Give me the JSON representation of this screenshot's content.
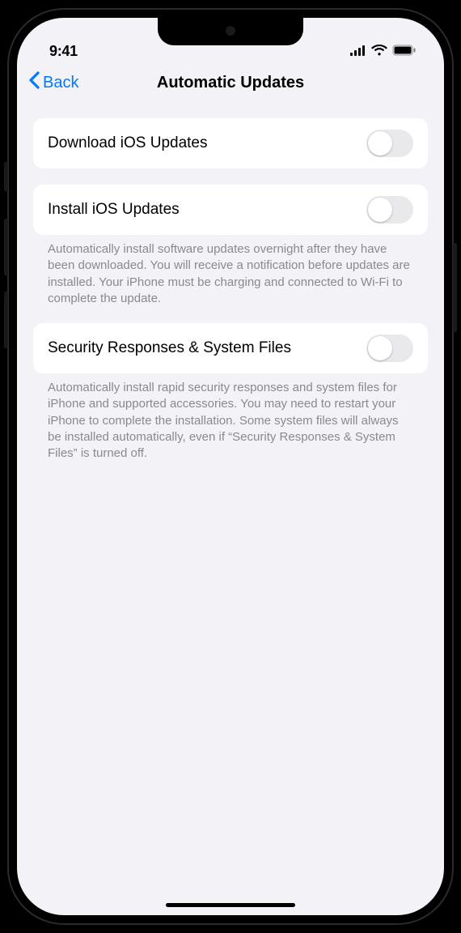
{
  "status": {
    "time": "9:41"
  },
  "nav": {
    "back_label": "Back",
    "title": "Automatic Updates"
  },
  "groups": [
    {
      "label": "Download iOS Updates",
      "toggle_on": false,
      "footer": ""
    },
    {
      "label": "Install iOS Updates",
      "toggle_on": false,
      "footer": "Automatically install software updates overnight after they have been downloaded. You will receive a notification before updates are installed. Your iPhone must be charging and connected to Wi-Fi to complete the update."
    },
    {
      "label": "Security Responses & System Files",
      "toggle_on": false,
      "footer": "Automatically install rapid security responses and system files for iPhone and supported accessories. You may need to restart your iPhone to complete the installation. Some system files will always be installed automatically, even if “Security Responses & System Files” is turned off."
    }
  ]
}
